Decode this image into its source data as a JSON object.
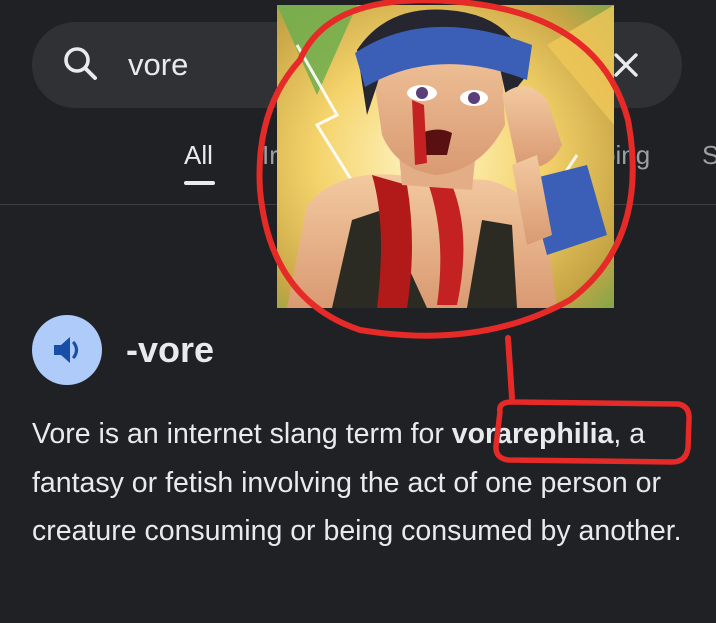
{
  "search": {
    "query": "vore",
    "icon": "search-icon",
    "clear_icon": "close-icon"
  },
  "tabs": [
    {
      "label": "All",
      "active": true
    },
    {
      "label": "Ir",
      "active": false
    },
    {
      "label": "ping",
      "active": false
    },
    {
      "label": "S",
      "active": false
    }
  ],
  "entry": {
    "audio_icon": "speaker-icon",
    "term": "-vore",
    "definition": {
      "before": "Vore is an internet slang term for ",
      "highlight": "vorarephilia",
      "after": ", a fantasy or fetish involving the act of one person or creature consuming or being consumed by another."
    }
  },
  "overlay": {
    "image": "anime-character-portrait",
    "annotation_color": "#e52a28"
  },
  "colors": {
    "background": "#202124",
    "search_bar": "#303134",
    "text_primary": "#e8eaed",
    "text_secondary": "#9aa0a6",
    "speaker_button": "#aecbfa",
    "speaker_icon": "#174ea6"
  }
}
